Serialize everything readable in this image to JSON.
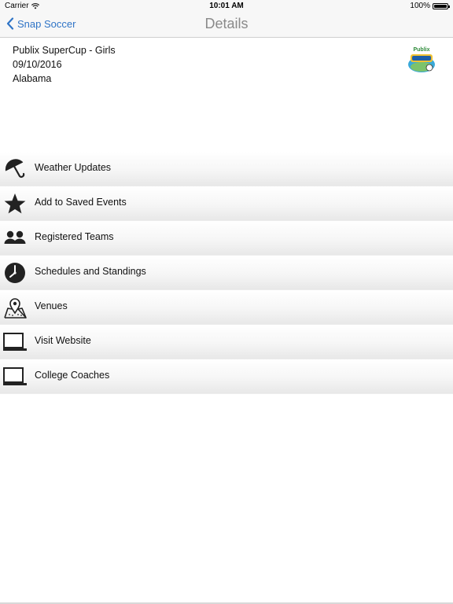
{
  "status_bar": {
    "carrier": "Carrier",
    "time": "10:01 AM",
    "battery": "100%",
    "battery_level": 1.0
  },
  "nav": {
    "back_label": "Snap Soccer",
    "title": "Details"
  },
  "event": {
    "name": "Publix SuperCup - Girls",
    "date": "09/10/2016",
    "location": "Alabama",
    "logo_text": "Publix"
  },
  "menu": {
    "items": [
      {
        "label": "Weather Updates",
        "icon": "umbrella-icon"
      },
      {
        "label": "Add to Saved Events",
        "icon": "star-icon"
      },
      {
        "label": "Registered Teams",
        "icon": "people-icon"
      },
      {
        "label": "Schedules and Standings",
        "icon": "clock-icon"
      },
      {
        "label": "Venues",
        "icon": "map-pin-icon"
      },
      {
        "label": "Visit Website",
        "icon": "laptop-icon"
      },
      {
        "label": "College Coaches",
        "icon": "laptop-icon"
      }
    ]
  },
  "colors": {
    "accent": "#2f74c6",
    "nav_background": "#f7f7f7",
    "title_gray": "#8a8a8a"
  }
}
